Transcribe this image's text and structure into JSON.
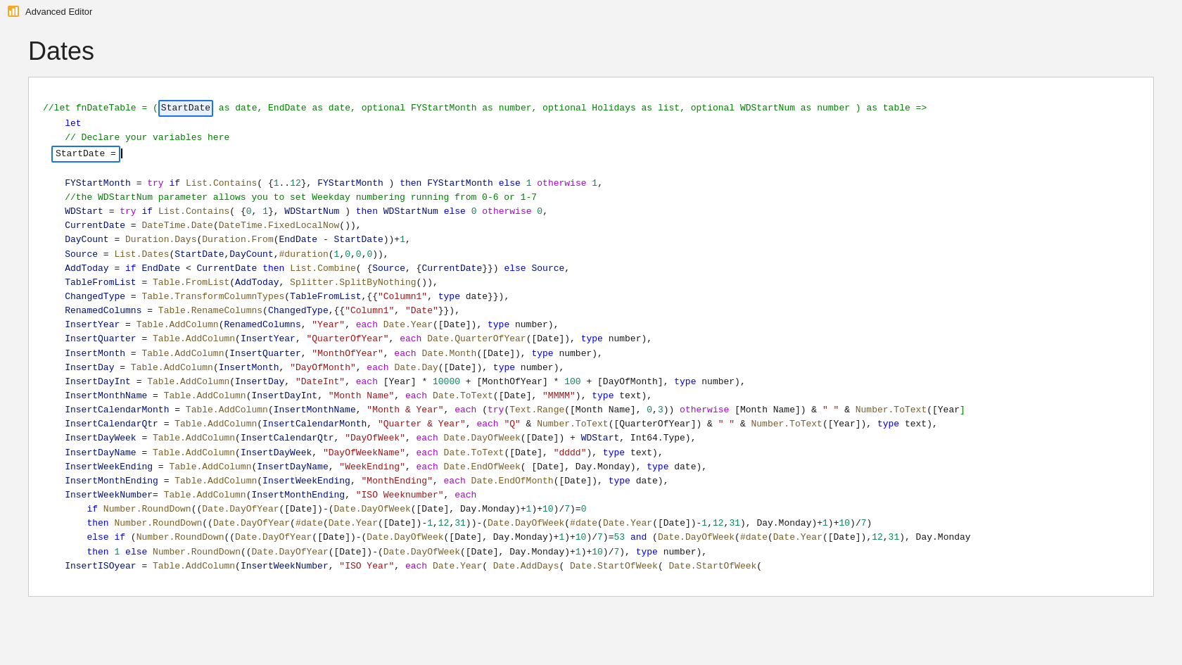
{
  "app": {
    "title": "Advanced Editor",
    "icon": "chart-icon"
  },
  "page": {
    "heading": "Dates"
  },
  "editor": {
    "lines": [
      "//let fnDateTable = (StartDate as date, EndDate as date, optional FYStartMonth as number, optional Holidays as list, optional WDStartNum as number ) as table =>",
      "    let",
      "    // Declare your variables here",
      "    StartDate = |",
      "",
      "    FYStartMonth = try if List.Contains( {1..12}, FYStartMonth ) then FYStartMonth else 1 otherwise 1,",
      "    //the WDStartNum parameter allows you to set Weekday numbering running from 0-6 or 1-7",
      "    WDStart = try if List.Contains( {0, 1}, WDStartNum ) then WDStartNum else 0 otherwise 0,",
      "    CurrentDate = DateTime.Date(DateTime.FixedLocalNow()),",
      "    DayCount = Duration.Days(Duration.From(EndDate - StartDate))+1,",
      "    Source = List.Dates(StartDate,DayCount,#duration(1,0,0,0)),",
      "    AddToday = if EndDate < CurrentDate then List.Combine( {Source, {CurrentDate}}) else Source,",
      "    TableFromList = Table.FromList(AddToday, Splitter.SplitByNothing()),",
      "    ChangedType = Table.TransformColumnTypes(TableFromList,{{\"Column1\", type date}}),",
      "    RenamedColumns = Table.RenameColumns(ChangedType,{{\"Column1\", \"Date\"}}),",
      "    InsertYear = Table.AddColumn(RenamedColumns, \"Year\", each Date.Year([Date]), type number),",
      "    InsertQuarter = Table.AddColumn(InsertYear, \"QuarterOfYear\", each Date.QuarterOfYear([Date]), type number),",
      "    InsertMonth = Table.AddColumn(InsertQuarter, \"MonthOfYear\", each Date.Month([Date]), type number),",
      "    InsertDay = Table.AddColumn(InsertMonth, \"DayOfMonth\", each Date.Day([Date]), type number),",
      "    InsertDayInt = Table.AddColumn(InsertDay, \"DateInt\", each [Year] * 10000 + [MonthOfYear] * 100 + [DayOfMonth], type number),",
      "    InsertMonthName = Table.AddColumn(InsertDayInt, \"Month Name\", each Date.ToText([Date], \"MMMM\"), type text),",
      "    InsertCalendarMonth = Table.AddColumn(InsertMonthName, \"Month & Year\", each (try(Text.Range([Month Name], 0,3)) otherwise [Month Name]) & \" \" & Number.ToText([Year",
      "    InsertCalendarQtr = Table.AddColumn(InsertCalendarMonth, \"Quarter & Year\", each \"Q\" & Number.ToText([QuarterOfYear]) & \" \" & Number.ToText([Year]), type text),",
      "    InsertDayWeek = Table.AddColumn(InsertCalendarQtr, \"DayOfWeek\", each Date.DayOfWeek([Date]) + WDStart, Int64.Type),",
      "    InsertDayName = Table.AddColumn(InsertDayWeek, \"DayOfWeekName\", each Date.ToText([Date], \"dddd\"), type text),",
      "    InsertWeekEnding = Table.AddColumn(InsertDayName, \"WeekEnding\", each Date.EndOfWeek( [Date], Day.Monday), type date),",
      "    InsertMonthEnding = Table.AddColumn(InsertWeekEnding, \"MonthEnding\", each Date.EndOfMonth([Date]), type date),",
      "    InsertWeekNumber= Table.AddColumn(InsertMonthEnding, \"ISO Weeknumber\", each",
      "        if Number.RoundDown((Date.DayOfYear([Date])-(Date.DayOfWeek([Date], Day.Monday)+1)+10)/7)=0",
      "        then Number.RoundDown((Date.DayOfYear(#date(Date.Year([Date])-1,12,31))-(Date.DayOfWeek(#date(Date.Year([Date])-1,12,31), Day.Monday)+1)+10)/7)",
      "        else if (Number.RoundDown((Date.DayOfYear([Date])-(Date.DayOfWeek([Date], Day.Monday)+1)+10)/7)=53 and (Date.DayOfWeek(#date(Date.Year([Date]),12,31), Day.Monday",
      "        then 1 else Number.RoundDown((Date.DayOfYear([Date])-(Date.DayOfWeek([Date], Day.Monday)+1)+10)/7), type number),",
      "    InsertISOyear = Table.AddColumn(InsertWeekNumber, \"ISO Year\", each Date.Year( Date.AddDays( Date.StartOfWeek( Date.StartOfWeek("
    ]
  }
}
